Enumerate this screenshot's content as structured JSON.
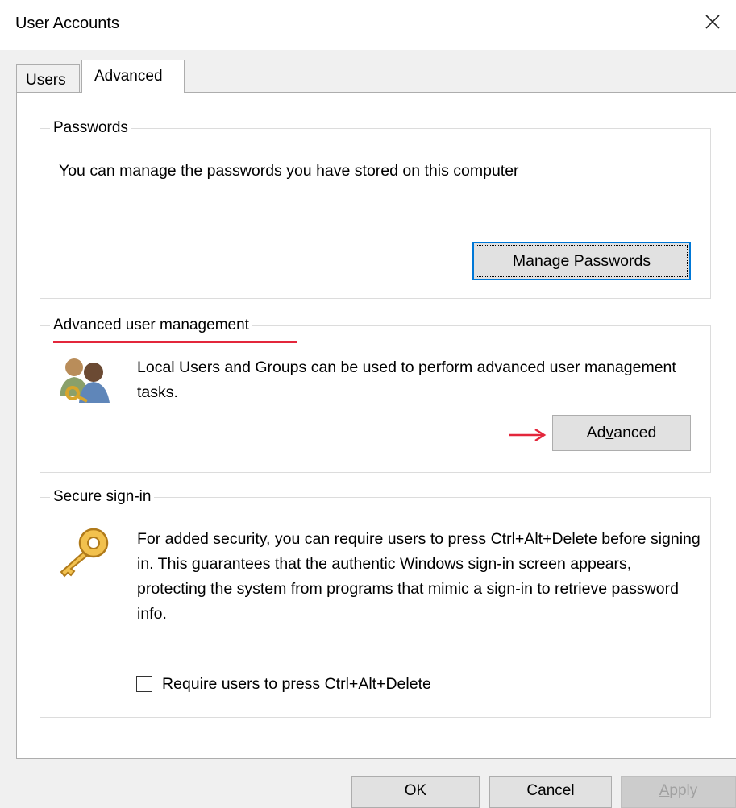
{
  "window": {
    "title": "User Accounts"
  },
  "tabs": [
    {
      "label": "Users"
    },
    {
      "label": "Advanced"
    }
  ],
  "passwords": {
    "legend": "Passwords",
    "description": "You can manage the passwords you have stored on this computer",
    "button": {
      "prefix": "",
      "mnemonic": "M",
      "suffix": "anage Passwords"
    }
  },
  "advanced_mgmt": {
    "legend": "Advanced user management",
    "description": "Local Users and Groups can be used to perform advanced user management tasks.",
    "button": {
      "prefix": "Ad",
      "mnemonic": "v",
      "suffix": "anced"
    }
  },
  "secure_signin": {
    "legend": "Secure sign-in",
    "description": "For added security, you can require users to press Ctrl+Alt+Delete before signing in. This guarantees that the authentic Windows sign-in screen appears, protecting the system from programs that mimic a sign-in to retrieve password info.",
    "checkbox": {
      "mnemonic": "R",
      "rest": "equire users to press Ctrl+Alt+Delete",
      "checked": false
    }
  },
  "footer": {
    "ok_label": "OK",
    "cancel_label": "Cancel",
    "apply": {
      "mnemonic": "A",
      "rest": "pply"
    }
  },
  "annotation_color": "#e3263b"
}
